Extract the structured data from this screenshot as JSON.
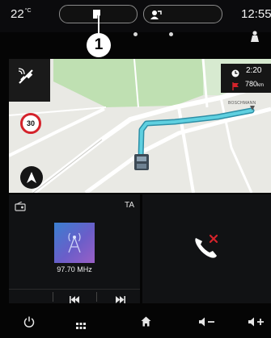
{
  "status_bar": {
    "temperature_value": "22",
    "temperature_unit": "°C",
    "time": "12:55",
    "callout_number": "1"
  },
  "map": {
    "speed_limit": "30",
    "trip": {
      "eta": "2:20",
      "distance_value": "780",
      "distance_unit": "km"
    },
    "poi_label": "BOSCHMANN"
  },
  "radio_widget": {
    "ta_label": "TA",
    "frequency": "97.70 MHz"
  },
  "icons": {
    "status_left": "phone-icon",
    "status_right": "contact-icon",
    "top_right": "person-icon",
    "gps": "satellite-icon",
    "compass": "navigation-arrow-icon",
    "radio_source": "radio-source-icon",
    "phone": "phone-missed-icon",
    "nav": [
      "power-icon",
      "apps-grid-icon",
      "home-icon",
      "volume-down-icon",
      "volume-up-icon"
    ]
  },
  "colors": {
    "route": "#5fd0e0",
    "speed_sign_border": "#d4232b",
    "missed_call": "#d4232b",
    "map_green": "#bfe0b2",
    "map_ground": "#e9e9e4"
  }
}
